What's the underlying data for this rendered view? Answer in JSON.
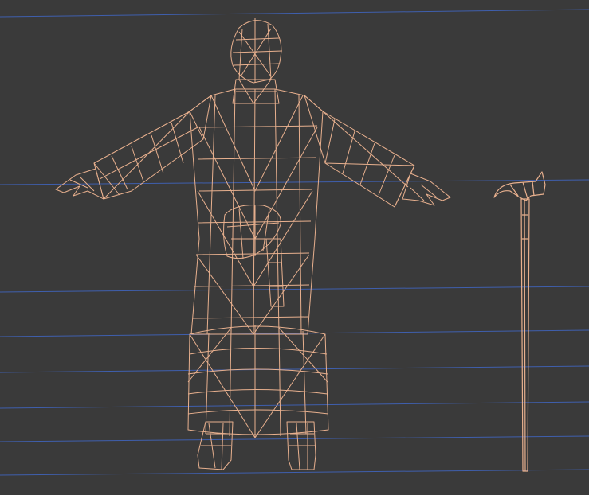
{
  "viewport": {
    "background_color": "#3a3a3a",
    "grid_line_color": "#3f5fae",
    "wireframe_color": "#e8b08e",
    "objects": [
      {
        "id": "character",
        "kind": "robed character, T-pose"
      },
      {
        "id": "walking-staff",
        "kind": "cane / walking staff"
      }
    ]
  }
}
